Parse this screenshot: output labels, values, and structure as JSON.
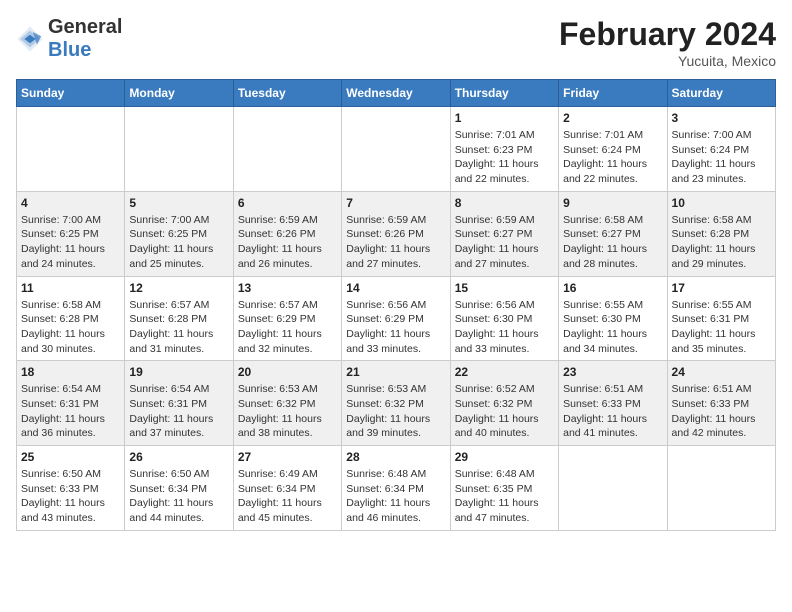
{
  "header": {
    "logo_general": "General",
    "logo_blue": "Blue",
    "month_year": "February 2024",
    "location": "Yucuita, Mexico"
  },
  "weekdays": [
    "Sunday",
    "Monday",
    "Tuesday",
    "Wednesday",
    "Thursday",
    "Friday",
    "Saturday"
  ],
  "weeks": [
    [
      {
        "day": "",
        "info": ""
      },
      {
        "day": "",
        "info": ""
      },
      {
        "day": "",
        "info": ""
      },
      {
        "day": "",
        "info": ""
      },
      {
        "day": "1",
        "info": "Sunrise: 7:01 AM\nSunset: 6:23 PM\nDaylight: 11 hours\nand 22 minutes."
      },
      {
        "day": "2",
        "info": "Sunrise: 7:01 AM\nSunset: 6:24 PM\nDaylight: 11 hours\nand 22 minutes."
      },
      {
        "day": "3",
        "info": "Sunrise: 7:00 AM\nSunset: 6:24 PM\nDaylight: 11 hours\nand 23 minutes."
      }
    ],
    [
      {
        "day": "4",
        "info": "Sunrise: 7:00 AM\nSunset: 6:25 PM\nDaylight: 11 hours\nand 24 minutes."
      },
      {
        "day": "5",
        "info": "Sunrise: 7:00 AM\nSunset: 6:25 PM\nDaylight: 11 hours\nand 25 minutes."
      },
      {
        "day": "6",
        "info": "Sunrise: 6:59 AM\nSunset: 6:26 PM\nDaylight: 11 hours\nand 26 minutes."
      },
      {
        "day": "7",
        "info": "Sunrise: 6:59 AM\nSunset: 6:26 PM\nDaylight: 11 hours\nand 27 minutes."
      },
      {
        "day": "8",
        "info": "Sunrise: 6:59 AM\nSunset: 6:27 PM\nDaylight: 11 hours\nand 27 minutes."
      },
      {
        "day": "9",
        "info": "Sunrise: 6:58 AM\nSunset: 6:27 PM\nDaylight: 11 hours\nand 28 minutes."
      },
      {
        "day": "10",
        "info": "Sunrise: 6:58 AM\nSunset: 6:28 PM\nDaylight: 11 hours\nand 29 minutes."
      }
    ],
    [
      {
        "day": "11",
        "info": "Sunrise: 6:58 AM\nSunset: 6:28 PM\nDaylight: 11 hours\nand 30 minutes."
      },
      {
        "day": "12",
        "info": "Sunrise: 6:57 AM\nSunset: 6:28 PM\nDaylight: 11 hours\nand 31 minutes."
      },
      {
        "day": "13",
        "info": "Sunrise: 6:57 AM\nSunset: 6:29 PM\nDaylight: 11 hours\nand 32 minutes."
      },
      {
        "day": "14",
        "info": "Sunrise: 6:56 AM\nSunset: 6:29 PM\nDaylight: 11 hours\nand 33 minutes."
      },
      {
        "day": "15",
        "info": "Sunrise: 6:56 AM\nSunset: 6:30 PM\nDaylight: 11 hours\nand 33 minutes."
      },
      {
        "day": "16",
        "info": "Sunrise: 6:55 AM\nSunset: 6:30 PM\nDaylight: 11 hours\nand 34 minutes."
      },
      {
        "day": "17",
        "info": "Sunrise: 6:55 AM\nSunset: 6:31 PM\nDaylight: 11 hours\nand 35 minutes."
      }
    ],
    [
      {
        "day": "18",
        "info": "Sunrise: 6:54 AM\nSunset: 6:31 PM\nDaylight: 11 hours\nand 36 minutes."
      },
      {
        "day": "19",
        "info": "Sunrise: 6:54 AM\nSunset: 6:31 PM\nDaylight: 11 hours\nand 37 minutes."
      },
      {
        "day": "20",
        "info": "Sunrise: 6:53 AM\nSunset: 6:32 PM\nDaylight: 11 hours\nand 38 minutes."
      },
      {
        "day": "21",
        "info": "Sunrise: 6:53 AM\nSunset: 6:32 PM\nDaylight: 11 hours\nand 39 minutes."
      },
      {
        "day": "22",
        "info": "Sunrise: 6:52 AM\nSunset: 6:32 PM\nDaylight: 11 hours\nand 40 minutes."
      },
      {
        "day": "23",
        "info": "Sunrise: 6:51 AM\nSunset: 6:33 PM\nDaylight: 11 hours\nand 41 minutes."
      },
      {
        "day": "24",
        "info": "Sunrise: 6:51 AM\nSunset: 6:33 PM\nDaylight: 11 hours\nand 42 minutes."
      }
    ],
    [
      {
        "day": "25",
        "info": "Sunrise: 6:50 AM\nSunset: 6:33 PM\nDaylight: 11 hours\nand 43 minutes."
      },
      {
        "day": "26",
        "info": "Sunrise: 6:50 AM\nSunset: 6:34 PM\nDaylight: 11 hours\nand 44 minutes."
      },
      {
        "day": "27",
        "info": "Sunrise: 6:49 AM\nSunset: 6:34 PM\nDaylight: 11 hours\nand 45 minutes."
      },
      {
        "day": "28",
        "info": "Sunrise: 6:48 AM\nSunset: 6:34 PM\nDaylight: 11 hours\nand 46 minutes."
      },
      {
        "day": "29",
        "info": "Sunrise: 6:48 AM\nSunset: 6:35 PM\nDaylight: 11 hours\nand 47 minutes."
      },
      {
        "day": "",
        "info": ""
      },
      {
        "day": "",
        "info": ""
      }
    ]
  ]
}
